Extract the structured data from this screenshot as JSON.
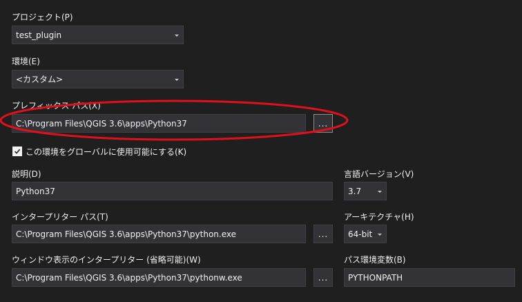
{
  "project": {
    "label": "プロジェクト(P)",
    "value": "test_plugin"
  },
  "environment": {
    "label": "環境(E)",
    "value": "<カスタム>"
  },
  "prefix_path": {
    "label": "プレフィックス パス(X)",
    "value": "C:\\Program Files\\QGIS 3.6\\apps\\Python37",
    "browse_label": "..."
  },
  "global_checkbox": {
    "label": "この環境をグローバルに使用可能にする(K)",
    "checked": true
  },
  "description": {
    "label": "説明(D)",
    "value": "Python37"
  },
  "language_version": {
    "label": "言語バージョン(V)",
    "value": "3.7"
  },
  "interpreter_path": {
    "label": "インタープリター パス(T)",
    "value": "C:\\Program Files\\QGIS 3.6\\apps\\Python37\\python.exe",
    "browse_label": "..."
  },
  "architecture": {
    "label": "アーキテクチャ(H)",
    "value": "64-bit"
  },
  "windowed_interpreter": {
    "label": "ウィンドウ表示のインタープリター (省略可能)(W)",
    "value": "C:\\Program Files\\QGIS 3.6\\apps\\Python37\\pythonw.exe",
    "browse_label": "..."
  },
  "path_env_var": {
    "label": "パス環境変数(B)",
    "value": "PYTHONPATH"
  },
  "colors": {
    "background": "#1f1f1f",
    "field": "#333337",
    "annotation": "#e0101c"
  }
}
